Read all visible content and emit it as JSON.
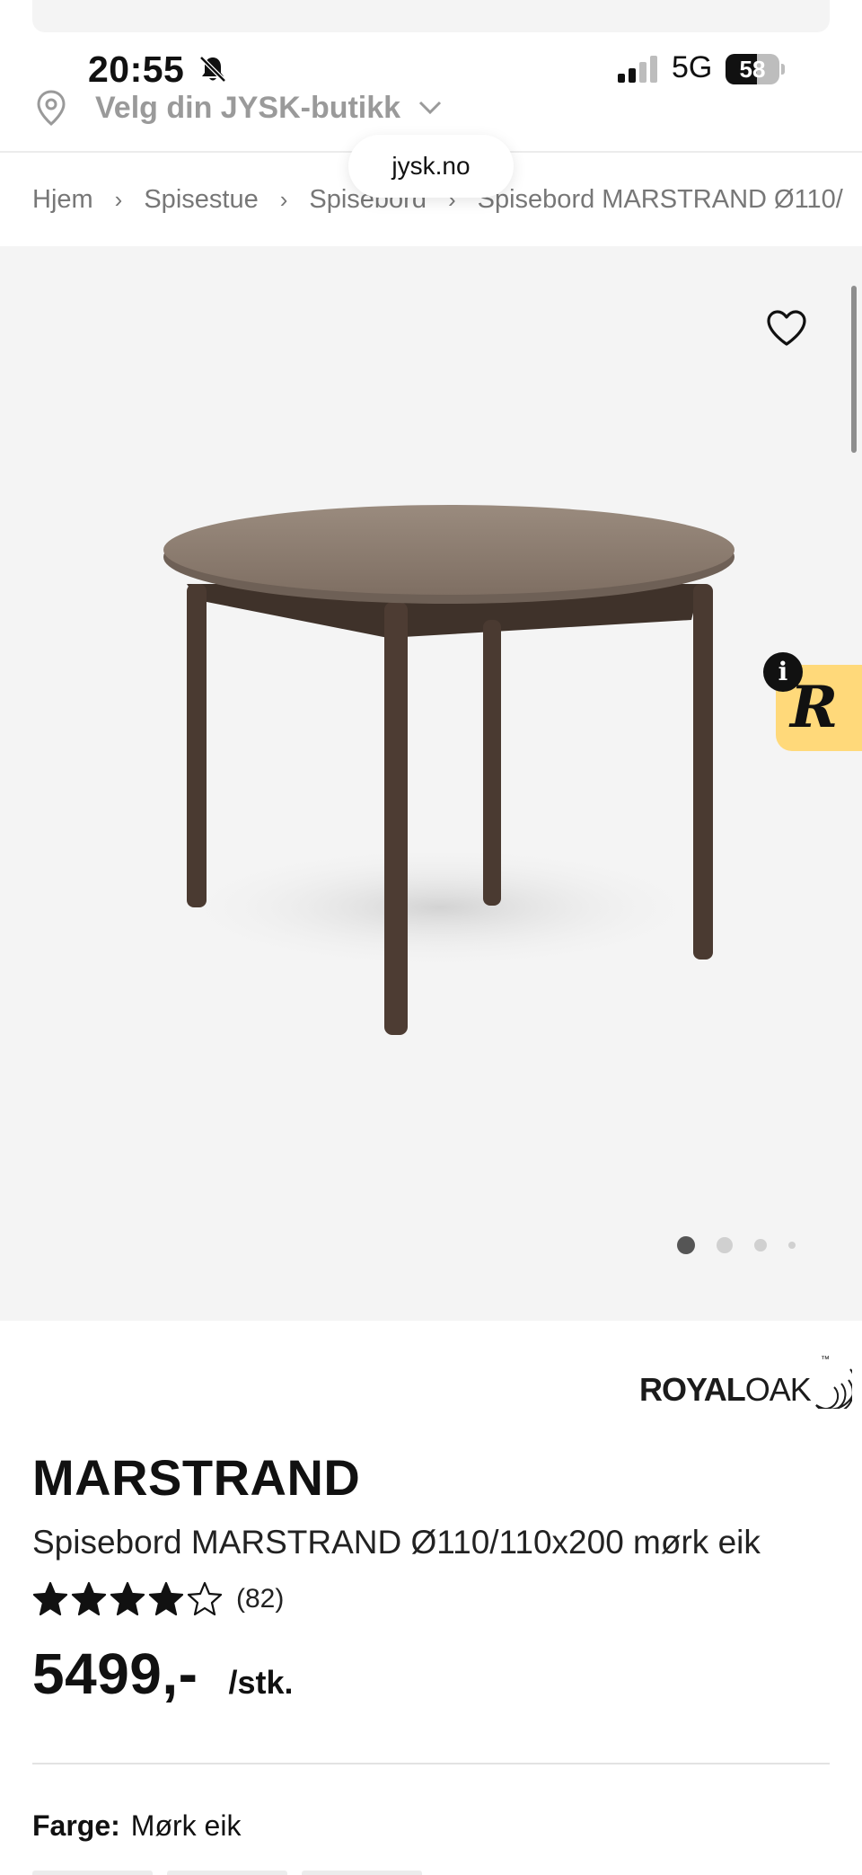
{
  "status_bar": {
    "time": "20:55",
    "network": "5G",
    "battery_level": 58,
    "battery_text": "58",
    "icons": [
      "bell-slash-icon",
      "signal-icon"
    ]
  },
  "header": {
    "store_selector_label": "Velg din JYSK-butikk",
    "url": "jysk.no"
  },
  "breadcrumb": [
    {
      "label": "Hjem"
    },
    {
      "label": "Spisestue"
    },
    {
      "label": "Spisebord"
    },
    {
      "label": "Spisebord MARSTRAND Ø110/"
    }
  ],
  "gallery": {
    "active_index": 0,
    "dot_count": 4
  },
  "badge": {
    "letter": "R",
    "info_glyph": "i"
  },
  "brand": {
    "part1": "ROYAL",
    "part2": "OAK",
    "tm": "™"
  },
  "product": {
    "name": "MARSTRAND",
    "subtitle": "Spisebord MARSTRAND Ø110/110x200 mørk eik",
    "rating": 4,
    "rating_max": 5,
    "rating_count": "(82)",
    "price": "5499,-",
    "price_unit": "/stk.",
    "color_label": "Farge:",
    "color_value": "Mørk eik"
  },
  "colors": {
    "gallery_bg": "#f4f4f4",
    "badge_yellow": "#ffd97a",
    "table_top": "#8d7e72",
    "table_legs": "#4a3a31"
  }
}
